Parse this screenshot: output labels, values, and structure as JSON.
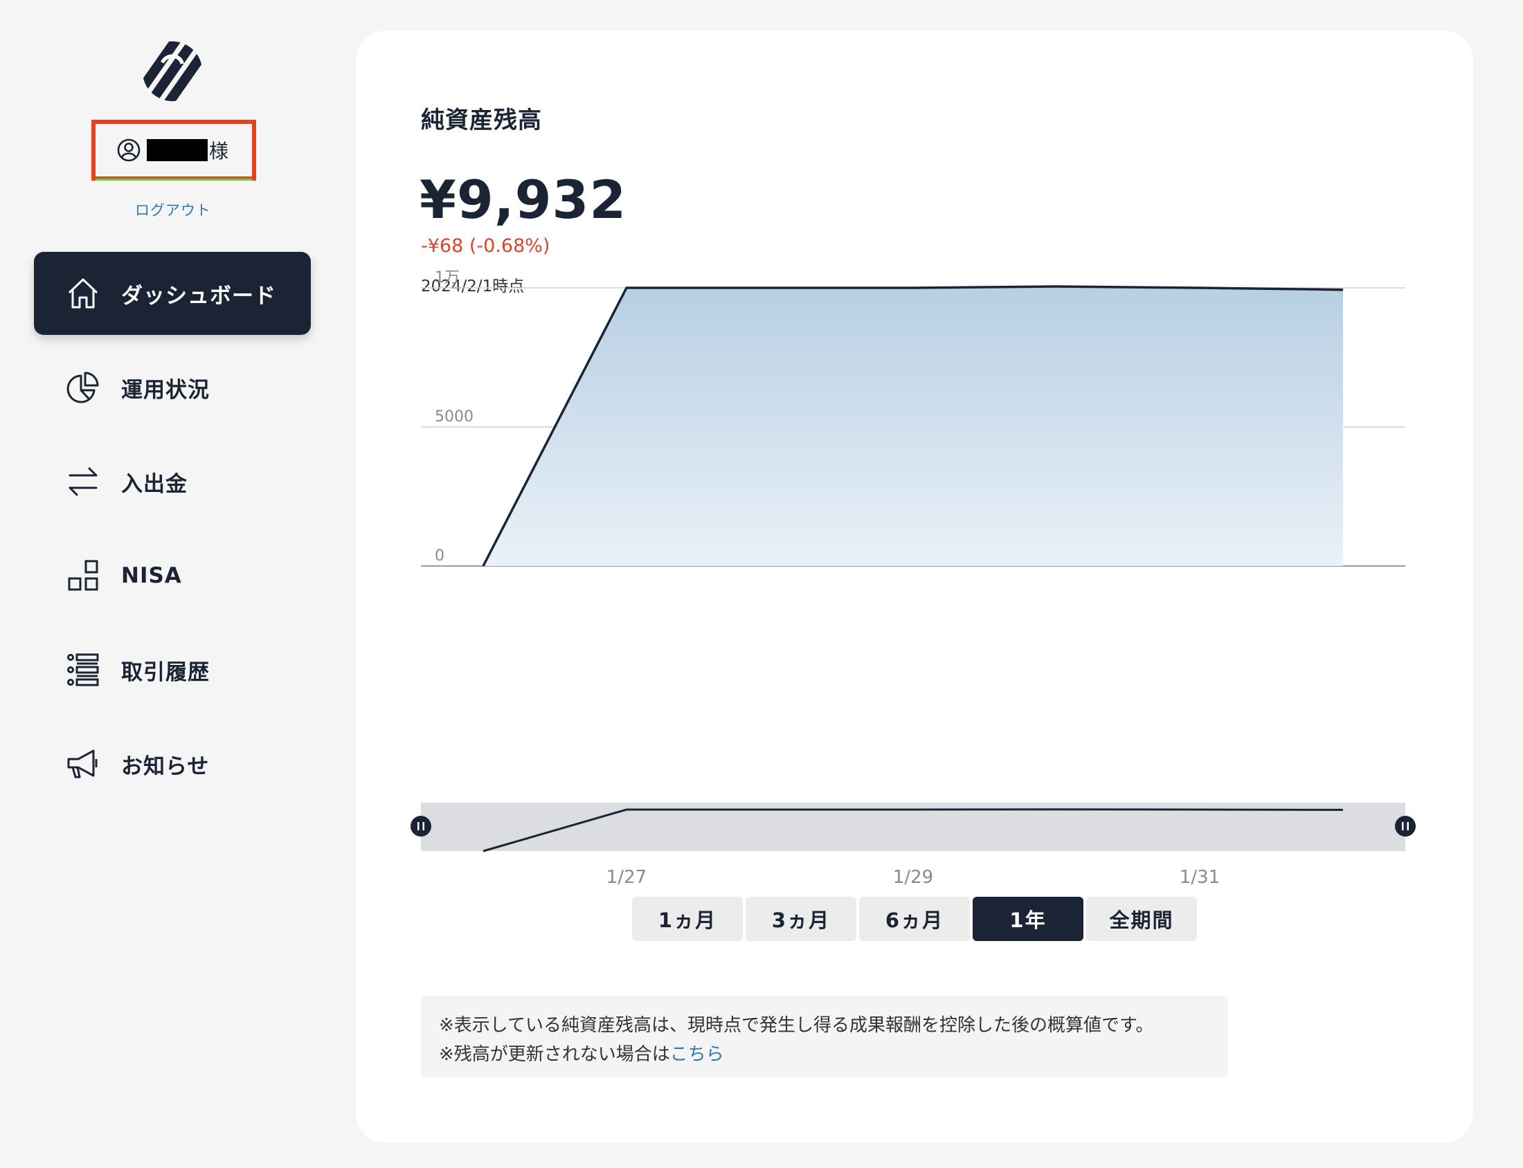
{
  "user": {
    "suffix": "様",
    "logout_label": "ログアウト"
  },
  "nav": {
    "items": [
      {
        "label": "ダッシュボード",
        "icon": "home-icon",
        "active": true
      },
      {
        "label": "運用状況",
        "icon": "pie-chart-icon",
        "active": false
      },
      {
        "label": "入出金",
        "icon": "transfer-arrows-icon",
        "active": false
      },
      {
        "label": "NISA",
        "icon": "blocks-icon",
        "active": false
      },
      {
        "label": "取引履歴",
        "icon": "list-icon",
        "active": false
      },
      {
        "label": "お知らせ",
        "icon": "megaphone-icon",
        "active": false
      }
    ]
  },
  "main": {
    "title": "純資産残高",
    "balance": "¥9,932",
    "change": "-¥68 (-0.68%)",
    "as_of": "2024/2/1時点",
    "ranges": [
      {
        "label": "1ヵ月",
        "active": false
      },
      {
        "label": "3ヵ月",
        "active": false
      },
      {
        "label": "6ヵ月",
        "active": false
      },
      {
        "label": "1年",
        "active": true
      },
      {
        "label": "全期間",
        "active": false
      }
    ],
    "notice_line1": "※表示している純資産残高は、現時点で発生し得る成果報酬を控除した後の概算値です。",
    "notice_line2_prefix": "※残高が更新されない場合は",
    "notice_link": "こちら"
  },
  "colors": {
    "accent": "#1b2434",
    "negative": "#d7462b",
    "link": "#2f79b8",
    "highlight_box": "#e8401f"
  },
  "chart_data": {
    "type": "area",
    "y_ticks": [
      "0",
      "5000",
      "1万"
    ],
    "ylim": [
      0,
      10000
    ],
    "x_ticks": [
      "1/27",
      "1/29",
      "1/31"
    ],
    "x": [
      "1/26",
      "1/27",
      "1/28",
      "1/29",
      "1/30",
      "1/31",
      "2/1"
    ],
    "values": [
      0,
      10000,
      10000,
      10000,
      10050,
      10000,
      9932
    ],
    "grid": true,
    "range_selector": true
  }
}
